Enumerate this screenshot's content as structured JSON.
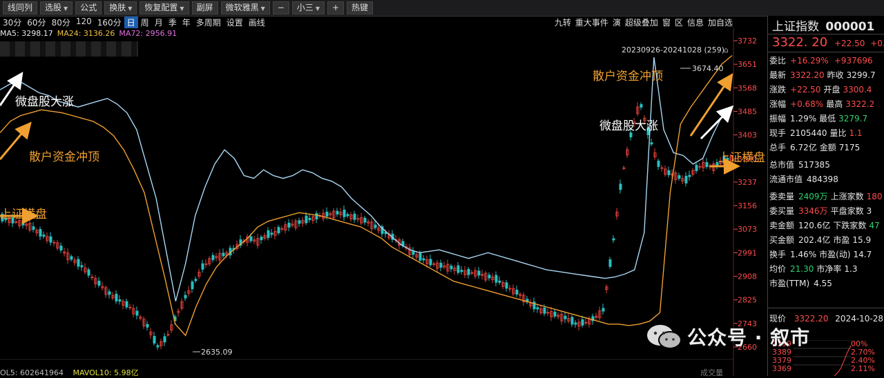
{
  "toolbar": {
    "items": [
      {
        "label": "线同列",
        "caret": false
      },
      {
        "label": "选股",
        "caret": true
      },
      {
        "label": "公式",
        "caret": false
      },
      {
        "label": "换肤",
        "caret": true
      },
      {
        "label": "恢复配置",
        "caret": true
      },
      {
        "label": "副屏",
        "caret": false
      },
      {
        "label": "微软雅黑",
        "caret": true
      },
      {
        "label": "−",
        "caret": false
      },
      {
        "label": "小三",
        "caret": true
      },
      {
        "label": "+",
        "caret": false
      },
      {
        "label": "热键",
        "caret": false
      }
    ]
  },
  "periods": [
    "30分",
    "60分",
    "80分",
    "120",
    "160分",
    "日",
    "周",
    "月",
    "季",
    "年",
    "多周期",
    "设置",
    "画线"
  ],
  "active_period": "日",
  "right_tools": [
    "九转",
    "重大事件",
    "演",
    "超级叠加",
    "窗",
    "区",
    "信息",
    "加自选"
  ],
  "ma": [
    {
      "label": "MA5: 3298.17",
      "color": "#e8e8e8"
    },
    {
      "label": "MA24: 3136.26",
      "color": "#f0c040"
    },
    {
      "label": "MA72: 2956.91",
      "color": "#e070e0"
    }
  ],
  "range_label": "20230926-20241028 (259)",
  "annotations": {
    "high_value": "3674.40",
    "low_value": "2635.09",
    "left_retail": "散户资金冲顶",
    "left_micro": "微盘股大涨",
    "left_sh": "上证横盘",
    "right_retail": "散户资金冲顶",
    "right_micro": "微盘股大涨",
    "right_sh": "上证横盘"
  },
  "yaxis": [
    "3732",
    "3651",
    "3568",
    "3485",
    "3403",
    "3320",
    "3237",
    "3156",
    "3073",
    "2991",
    "2908",
    "2825",
    "2743",
    "2660"
  ],
  "bottom_legend": {
    "vol": "OL5: 602641964",
    "mavol": "MAVOL10: 5.98亿",
    "chengjiao": "成交量"
  },
  "panel": {
    "name": "上证指数",
    "code": "000001",
    "price": "3322. 20",
    "change": "+22.50",
    "pct": "+0.68",
    "rows": [
      {
        "a": "委比",
        "av": "+16.29%",
        "ac": "red",
        "b": "",
        "bv": "+937696",
        "bc": "red"
      },
      {
        "a": "最新",
        "av": "3322.20",
        "ac": "red",
        "b": "昨收",
        "bv": "3299.7",
        "bc": "white"
      },
      {
        "a": "涨跌",
        "av": "+22.50",
        "ac": "red",
        "b": "开盘",
        "bv": "3300.4",
        "bc": "red"
      },
      {
        "a": "涨幅",
        "av": "+0.68%",
        "ac": "red",
        "b": "最高",
        "bv": "3322.2",
        "bc": "red"
      },
      {
        "a": "振幅",
        "av": "1.29%",
        "ac": "white",
        "b": "最低",
        "bv": "3279.7",
        "bc": "green"
      },
      {
        "a": "现手",
        "av": "2105440",
        "ac": "white",
        "b": "量比",
        "bv": "1.1",
        "bc": "red"
      },
      {
        "a": "总手",
        "av": "6.72亿",
        "ac": "white",
        "b": "金额",
        "bv": "7175",
        "bc": "white"
      },
      {
        "a": "总市值",
        "av": "517385",
        "ac": "white",
        "b": "",
        "bv": "",
        "bc": "white"
      },
      {
        "a": "流通市值",
        "av": "484398",
        "ac": "white",
        "b": "",
        "bv": "",
        "bc": "white"
      },
      {
        "a": "委卖量",
        "av": "2409万",
        "ac": "green",
        "b": "上涨家数",
        "bv": "180",
        "bc": "red"
      },
      {
        "a": "委买量",
        "av": "3346万",
        "ac": "red",
        "b": "平盘家数",
        "bv": "3",
        "bc": "white"
      },
      {
        "a": "卖金额",
        "av": "120.6亿",
        "ac": "white",
        "b": "下跌家数",
        "bv": "47",
        "bc": "green"
      },
      {
        "a": "买金额",
        "av": "202.4亿",
        "ac": "white",
        "b": "市盈",
        "bv": "15.9",
        "bc": "white"
      },
      {
        "a": "换手",
        "av": "1.46%",
        "ac": "white",
        "b": "市盈(动)",
        "bv": "14.7",
        "bc": "white"
      },
      {
        "a": "均价",
        "av": "21.30",
        "ac": "green",
        "b": "市净率",
        "bv": "1.3",
        "bc": "white"
      },
      {
        "a": "市盈(TTM)",
        "av": "4.55",
        "ac": "white",
        "b": "",
        "bv": "",
        "bc": "white"
      }
    ],
    "now_label": "现价",
    "now_price": "3322.20",
    "now_date": "2024-10-28",
    "mini_left": [
      "3399",
      "3389",
      "3379",
      "3369"
    ],
    "mini_right": [
      "00%",
      "2.70%",
      "2.40%",
      "2.11%"
    ]
  },
  "watermark": {
    "text": "公众号 · 叙市"
  },
  "chart_data": {
    "type": "line",
    "x_range": [
      "20230926",
      "20241028"
    ],
    "y_range": [
      2635.09,
      3674.4
    ],
    "yticks": [
      3732,
      3651,
      3568,
      3485,
      3403,
      3320,
      3237,
      3156,
      3073,
      2991,
      2908,
      2825,
      2743,
      2660
    ],
    "series": [
      {
        "name": "上证指数",
        "color": "#5fa8d0",
        "values": [
          3110,
          3102,
          3095,
          3085,
          3060,
          3040,
          3020,
          2985,
          2960,
          2935,
          2900,
          2870,
          2840,
          2820,
          2800,
          2770,
          2730,
          2660,
          2690,
          2760,
          2830,
          2880,
          2940,
          2970,
          2980,
          2990,
          3020,
          3040,
          3030,
          3050,
          3060,
          3080,
          3090,
          3100,
          3110,
          3120,
          3125,
          3130,
          3120,
          3110,
          3100,
          3080,
          3060,
          3040,
          3020,
          2990,
          2970,
          2955,
          2945,
          2940,
          2930,
          2920,
          2920,
          2910,
          2900,
          2880,
          2860,
          2840,
          2810,
          2790,
          2780,
          2770,
          2760,
          2740,
          2745,
          2760,
          2790,
          3010,
          3250,
          3400,
          3520,
          3400,
          3300,
          3270,
          3260,
          3240,
          3280,
          3300,
          3290,
          3310,
          3322
        ]
      },
      {
        "name": "微盘股",
        "color": "#a9d8f5",
        "values": [
          3560,
          3580,
          3590,
          3570,
          3550,
          3540,
          3520,
          3510,
          3500,
          3510,
          3520,
          3530,
          3510,
          3480,
          3420,
          3300,
          3180,
          3000,
          2820,
          2950,
          3120,
          3220,
          3300,
          3350,
          3320,
          3260,
          3250,
          3280,
          3260,
          3250,
          3260,
          3280,
          3270,
          3250,
          3240,
          3220,
          3180,
          3150,
          3120,
          3080,
          3050,
          3020,
          3000,
          2990,
          2995,
          3000,
          2990,
          2980,
          2970,
          2980,
          2990,
          2980,
          2970,
          2960,
          2950,
          2940,
          2930,
          2925,
          2920,
          2915,
          2910,
          2905,
          2900,
          2905,
          2915,
          2930,
          3060,
          3674,
          3420,
          3340,
          3330,
          3300,
          3320,
          3400,
          3470,
          3500
        ]
      },
      {
        "name": "散户资金",
        "color": "#f0a030",
        "values": [
          3410,
          3450,
          3470,
          3480,
          3490,
          3485,
          3480,
          3470,
          3460,
          3450,
          3430,
          3400,
          3350,
          3280,
          3200,
          3050,
          2900,
          2740,
          2700,
          2800,
          2880,
          2940,
          2980,
          3010,
          3040,
          3080,
          3100,
          3110,
          3120,
          3130,
          3125,
          3120,
          3110,
          3100,
          3090,
          3080,
          3060,
          3040,
          3010,
          2990,
          2970,
          2950,
          2930,
          2910,
          2890,
          2880,
          2870,
          2860,
          2850,
          2840,
          2830,
          2820,
          2810,
          2800,
          2790,
          2780,
          2770,
          2760,
          2750,
          2740,
          2740,
          2735,
          2740,
          2750,
          2780,
          3200,
          3440,
          3500,
          3550,
          3600,
          3650,
          3680
        ]
      }
    ]
  }
}
